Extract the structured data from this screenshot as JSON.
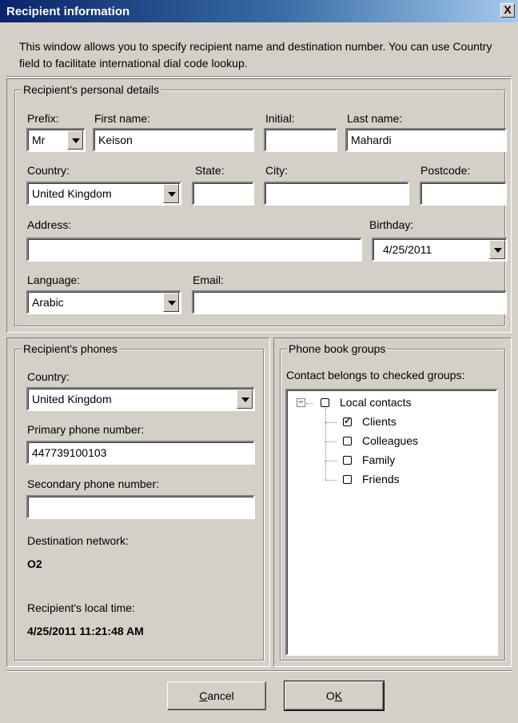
{
  "window": {
    "title": "Recipient information",
    "close_glyph": "X"
  },
  "intro": "This window allows you to specify recipient name and destination number. You can use Country field to facilitate international dial code lookup.",
  "personal": {
    "legend": "Recipient's personal details",
    "prefix_label": "Prefix:",
    "prefix_value": "Mr",
    "first_name_label": "First name:",
    "first_name_value": "Keison",
    "initial_label": "Initial:",
    "initial_value": "",
    "last_name_label": "Last name:",
    "last_name_value": "Mahardi",
    "country_label": "Country:",
    "country_value": "United Kingdom",
    "state_label": "State:",
    "state_value": "",
    "city_label": "City:",
    "city_value": "",
    "postcode_label": "Postcode:",
    "postcode_value": "",
    "address_label": "Address:",
    "address_value": "",
    "birthday_label": "Birthday:",
    "birthday_value": "4/25/2011",
    "language_label": "Language:",
    "language_value": "Arabic",
    "email_label": "Email:",
    "email_value": ""
  },
  "phones": {
    "legend": "Recipient's phones",
    "country_label": "Country:",
    "country_value": "United Kingdom",
    "primary_label": "Primary phone number:",
    "primary_value": "447739100103",
    "secondary_label": "Secondary phone number:",
    "secondary_value": "",
    "network_label": "Destination network:",
    "network_value": "O2",
    "local_time_label": "Recipient's local time:",
    "local_time_value": "4/25/2011 11:21:48 AM"
  },
  "groups": {
    "legend": "Phone book groups",
    "caption": "Contact belongs to checked groups:",
    "root": {
      "label": "Local contacts",
      "checked": false,
      "expander": "−"
    },
    "items": [
      {
        "label": "Clients",
        "checked": true
      },
      {
        "label": "Colleagues",
        "checked": false
      },
      {
        "label": "Family",
        "checked": false
      },
      {
        "label": "Friends",
        "checked": false
      }
    ]
  },
  "buttons": {
    "cancel_pre": "",
    "cancel_key": "C",
    "cancel_post": "ancel",
    "ok_pre": "O",
    "ok_key": "K",
    "ok_post": ""
  }
}
